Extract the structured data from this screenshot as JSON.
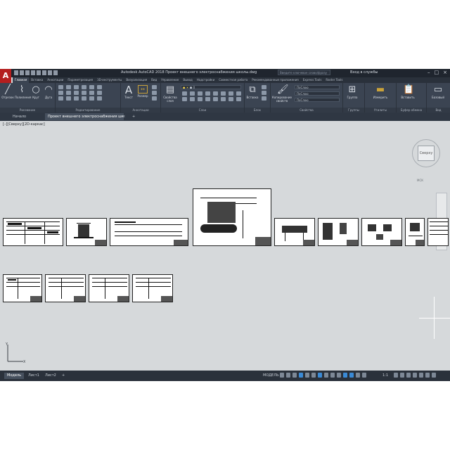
{
  "app": {
    "title": "Autodesk AutoCAD 2018   Проект внешнего электроснабжения школы.dwg",
    "search_placeholder": "Введите ключевое слово/фразу",
    "signin": "Вход в службы",
    "logo": "A"
  },
  "ribbon_tabs": [
    "Главная",
    "Вставка",
    "Аннотации",
    "Параметризация",
    "3D-инструменты",
    "Визуализация",
    "Вид",
    "Управление",
    "Вывод",
    "Надстройки",
    "Совместная работа",
    "Рекомендованные приложения",
    "Express Tools",
    "Raster Tools"
  ],
  "ribbon": {
    "draw_buttons": [
      "Отрезок",
      "Полилиния",
      "Круг",
      "Дуга"
    ],
    "panel_titles": {
      "draw": "Рисование",
      "modify": "Редактирование",
      "annotation": "Аннотации",
      "layers": "Слои",
      "block": "Блок",
      "properties": "Свойства",
      "groups": "Группы",
      "utilities": "Утилиты",
      "clipboard": "Буфер обмена",
      "view": "Вид"
    },
    "text_button": "Текст",
    "dim_button": "Размер",
    "layer_props": "Свойства слоя",
    "insert_button": "Вставка",
    "match_props": "Копирование свойств",
    "groups_button": "Группа",
    "measure_button": "Измерить",
    "paste_button": "Вставить",
    "base_button": "Базовый",
    "bylayer_1": "ПоСлою",
    "bylayer_2": "ПоСлою",
    "bylayer_3": "ПоСлою"
  },
  "doc_tabs": {
    "start": "Начало",
    "active": "Проект внешнего электроснабжения школы",
    "close": "×",
    "add": "+"
  },
  "viewport": {
    "label": "[–][Сверху][2D-каркас]",
    "viewcube_face": "Сверху",
    "wcs": "МСК"
  },
  "layout_tabs": [
    "Модель",
    "Лист1",
    "Лист2"
  ],
  "status": {
    "model": "МОДЕЛЬ",
    "scale": "1:1"
  },
  "colors": {
    "ribbon_bg": "#3b4452",
    "titlebar_bg": "#1f252e",
    "canvas_bg": "#d6d9db",
    "logo_red": "#b41e1e",
    "status_accent": "#3a8ad6"
  },
  "icons": [
    "autocad-logo-icon",
    "new-icon",
    "open-icon",
    "save-icon",
    "print-icon",
    "undo-icon",
    "redo-icon",
    "line-icon",
    "polyline-icon",
    "circle-icon",
    "arc-icon",
    "text-icon",
    "ucs-icon",
    "viewcube-icon"
  ]
}
